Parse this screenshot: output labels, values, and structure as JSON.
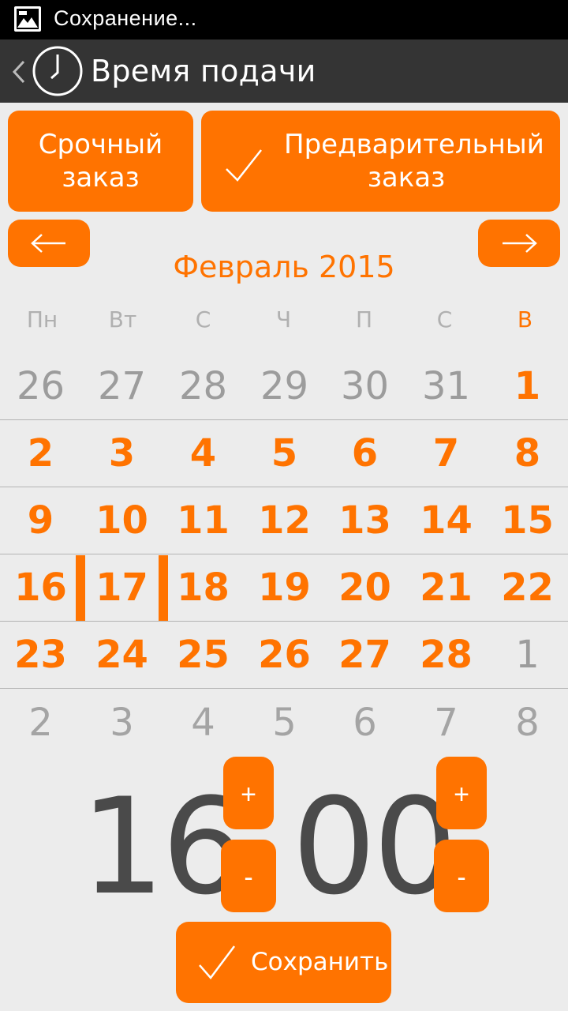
{
  "status_bar": {
    "text": "Сохранение...",
    "icon": "image-icon"
  },
  "action_bar": {
    "title": "Время подачи",
    "back_icon": "chevron-left-icon",
    "app_icon": "clock-icon"
  },
  "order_type": {
    "urgent_label": "Срочный\nзаказ",
    "advance_label": "Предварительный\nзаказ",
    "selected": "advance"
  },
  "calendar": {
    "month_title": "Февраль 2015",
    "weekdays": [
      "Пн",
      "Вт",
      "С",
      "Ч",
      "П",
      "С",
      "В"
    ],
    "rows": [
      [
        "26",
        "27",
        "28",
        "29",
        "30",
        "31",
        "1"
      ],
      [
        "2",
        "3",
        "4",
        "5",
        "6",
        "7",
        "8"
      ],
      [
        "9",
        "10",
        "11",
        "12",
        "13",
        "14",
        "15"
      ],
      [
        "16",
        "17",
        "18",
        "19",
        "20",
        "21",
        "22"
      ],
      [
        "23",
        "24",
        "25",
        "26",
        "27",
        "28",
        "1"
      ],
      [
        "2",
        "3",
        "4",
        "5",
        "6",
        "7",
        "8"
      ]
    ],
    "selected_day": "17"
  },
  "time": {
    "hours": "16",
    "minutes": "00",
    "plus_label": "+",
    "minus_label": "-"
  },
  "save_label": "Сохранить",
  "colors": {
    "accent": "#ff7300",
    "action_bar": "#343434",
    "background": "#ececec",
    "muted": "#9c9c9c"
  }
}
